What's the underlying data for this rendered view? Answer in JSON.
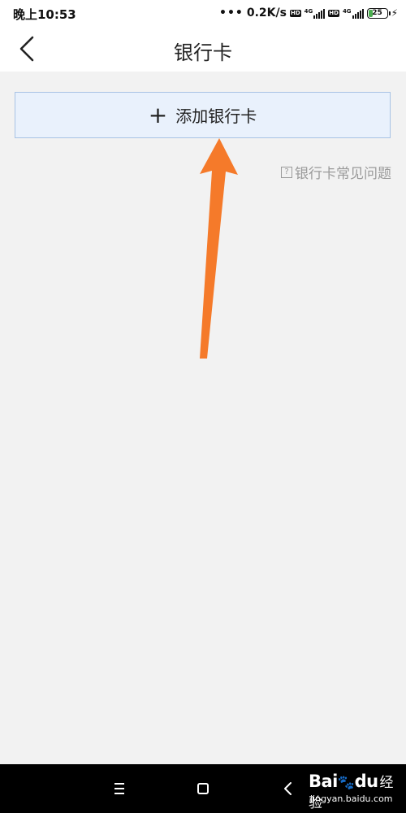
{
  "status_bar": {
    "time": "晚上10:53",
    "dots": "•••",
    "speed": "0.2K/s",
    "hd": "HD",
    "net1": "4G",
    "net2": "4G",
    "battery": "25",
    "battery_level": 0.25
  },
  "header": {
    "title": "银行卡"
  },
  "main": {
    "add_card_icon": "+",
    "add_card_label": "添加银行卡",
    "faq_icon": "?",
    "faq_label": "银行卡常见问题"
  },
  "watermark": {
    "logo_bai": "Bai",
    "logo_paw": "🐾",
    "logo_du": "du",
    "logo_cn": "经验",
    "url": "jingyan.baidu.com"
  },
  "colors": {
    "background": "#f2f2f2",
    "button_fill": "#e9f1fc",
    "button_border": "#a8c2e4",
    "arrow": "#f57a2a",
    "faq_text": "#9a9a9a",
    "battery": "#4caf50"
  },
  "icons": {
    "back": "chevron-left-icon",
    "plus": "plus-icon",
    "faq": "question-box-icon",
    "nav_menu": "menu-icon",
    "nav_home": "home-square-icon",
    "nav_back": "back-chevron-icon"
  }
}
